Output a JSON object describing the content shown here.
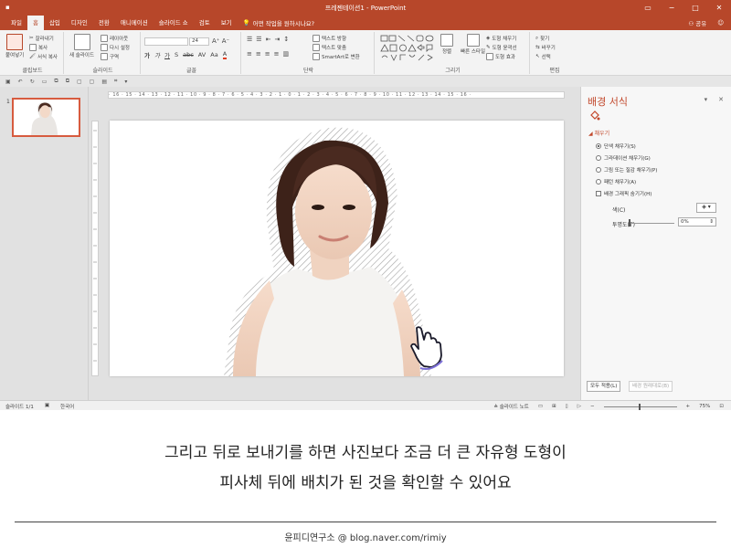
{
  "window": {
    "title": "프레젠테이션1 - PowerPoint",
    "controls": [
      "▭",
      "−",
      "□",
      "✕"
    ]
  },
  "tabs": {
    "items": [
      "파일",
      "홈",
      "삽입",
      "디자인",
      "전환",
      "애니메이션",
      "슬라이드 쇼",
      "검토",
      "보기"
    ],
    "active_index": 1,
    "tell_me": "어떤 작업을 원하시나요?",
    "user": "로그인",
    "share": "공유"
  },
  "ribbon": {
    "clipboard": {
      "paste": "붙여넣기",
      "cut": "잘라내기",
      "copy": "복사",
      "format_painter": "서식 복사",
      "label": "클립보드"
    },
    "slides": {
      "new_slide": "새 슬라이드",
      "layout": "레이아웃",
      "reset": "다시 설정",
      "section": "구역",
      "label": "슬라이드"
    },
    "font": {
      "font_size": "24",
      "label": "글꼴",
      "buttons": [
        "가",
        "가",
        "가",
        "S",
        "abc",
        "AV",
        "Aa",
        "A"
      ]
    },
    "paragraph": {
      "text_direction": "텍스트 방향",
      "align_text": "텍스트 맞춤",
      "smartart": "SmartArt로 변환",
      "label": "단락"
    },
    "drawing": {
      "arrange": "정렬",
      "quick_styles": "빠른 스타일",
      "shape_fill": "도형 채우기",
      "shape_outline": "도형 윤곽선",
      "shape_effects": "도형 효과",
      "label": "그리기"
    },
    "editing": {
      "find": "찾기",
      "replace": "바꾸기",
      "select": "선택",
      "label": "편집"
    }
  },
  "thumbnails": {
    "number": "1"
  },
  "ruler": {
    "labels": "· 16 · 15 · 14 · 13 · 12 · 11 · 10 · 9 · 8 · 7 · 6 · 5 · 4 · 3 · 2 · 1 · 0 · 1 · 2 · 3 · 4 · 5 · 6 · 7 · 8 · 9 · 10 · 11 · 12 · 13 · 14 · 15 · 16 ·"
  },
  "format_pane": {
    "title": "배경 서식",
    "section": "채우기",
    "options": [
      "단색 채우기(S)",
      "그라데이션 채우기(G)",
      "그림 또는 질감 채우기(P)",
      "패턴 채우기(A)"
    ],
    "selected_index": 0,
    "hide_graphics": "배경 그래픽 숨기기(H)",
    "color_label": "색(C)",
    "transparency_label": "투명도(T)",
    "transparency_value": "0%",
    "apply_all": "모두 적용(L)",
    "reset_background": "배경 원래대로(B)"
  },
  "status": {
    "slide_info": "슬라이드 1/1",
    "language": "한국어",
    "notes": "슬라이드 노트",
    "zoom": "75%"
  },
  "caption": {
    "line1": "그리고 뒤로 보내기를 하면 사진보다 조금 더 큰 자유형 도형이",
    "line2": "피사체 뒤에 배치가 된 것을 확인할 수 있어요"
  },
  "footer": "윤피디연구소 @ blog.naver.com/rimiy",
  "colors": {
    "accent": "#b7472a",
    "pane_title": "#c2482b",
    "workspace": "#e1e1e1"
  }
}
